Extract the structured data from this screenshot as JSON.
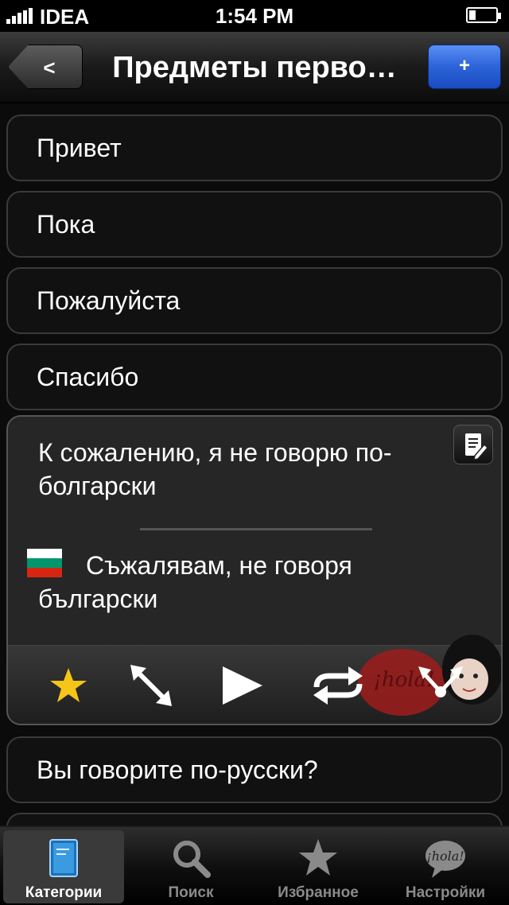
{
  "status_bar": {
    "carrier": "IDEA",
    "time": "1:54 PM",
    "battery_level": 0.25
  },
  "nav": {
    "back_label": "<",
    "title": "Предметы перво…",
    "add_label": "+"
  },
  "phrases": [
    {
      "text": "Привет"
    },
    {
      "text": "Пока"
    },
    {
      "text": "Пожалуйста"
    },
    {
      "text": "Спасибо"
    }
  ],
  "expanded": {
    "phrase": "К сожалению, я не говорю по-болгарски",
    "translation": "Съжалявам, не говоря български",
    "flag_colors": [
      "#ffffff",
      "#00966e",
      "#d62612"
    ],
    "hola_text": "¡hola!",
    "toolbar": [
      "star-icon",
      "expand-icon",
      "play-icon",
      "repeat-icon",
      "share-icon"
    ]
  },
  "phrases_after": [
    {
      "text": "Вы говорите по-русски?"
    }
  ],
  "tabs": [
    {
      "label": "Категории",
      "icon": "book-icon",
      "active": true
    },
    {
      "label": "Поиск",
      "icon": "search-icon",
      "active": false
    },
    {
      "label": "Избранное",
      "icon": "star-icon",
      "active": false
    },
    {
      "label": "Настройки",
      "icon": "hola-bubble-icon",
      "active": false
    }
  ],
  "colors": {
    "accent": "#2c63d8",
    "star": "#f5c518"
  }
}
